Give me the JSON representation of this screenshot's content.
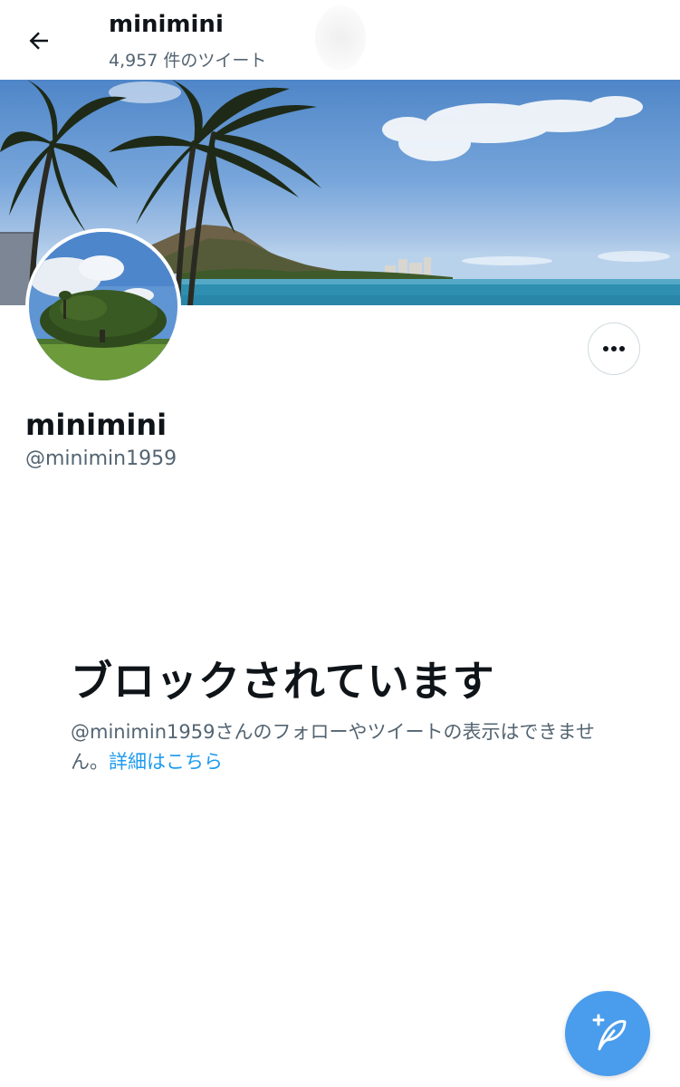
{
  "header": {
    "title": "minimini",
    "tweet_count": "4,957 件のツイート"
  },
  "profile": {
    "display_name": "minimini",
    "handle": "@minimin1959"
  },
  "blocked": {
    "title": "ブロックされています",
    "description": "@minimin1959さんのフォローやツイートの表示はできません。",
    "link": "詳細はこちら"
  },
  "icons": {
    "back": "arrow-left-icon",
    "more": "more-dots-icon",
    "compose": "compose-tweet-icon"
  },
  "colors": {
    "accent": "#1d9bf0",
    "secondary_text": "#536471",
    "primary_text": "#0f1419"
  }
}
